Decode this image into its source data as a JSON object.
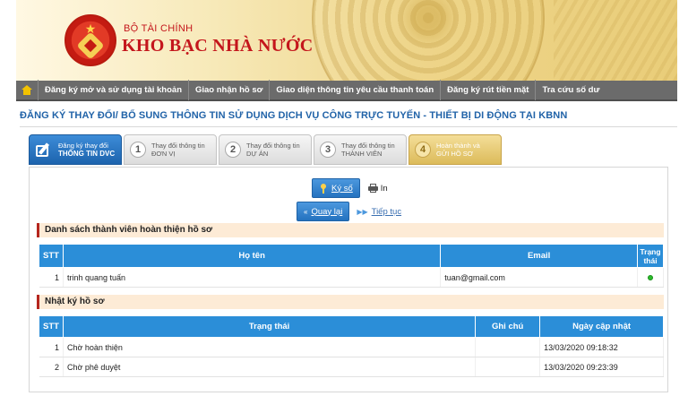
{
  "header": {
    "brand_line1": "BỘ TÀI CHÍNH",
    "brand_line2": "KHO BẠC NHÀ NƯỚC"
  },
  "nav": {
    "items": [
      "Đăng ký mở và sử dụng tài khoản",
      "Giao nhận hồ sơ",
      "Giao diện thông tin yêu cầu thanh toán",
      "Đăng ký rút tiền mặt",
      "Tra cứu số dư"
    ]
  },
  "page_title": "ĐĂNG KÝ THAY ĐỔI/ BỔ SUNG THÔNG TIN SỬ DỤNG DỊCH VỤ CÔNG TRỰC TUYẾN - THIẾT BỊ DI ĐỘNG TẠI KBNN",
  "steps": [
    {
      "num": "",
      "line1": "Đăng ký thay đổi",
      "line2": "THÔNG TIN DVC"
    },
    {
      "num": "1",
      "line1": "Thay đổi thông tin",
      "line2": "ĐƠN VỊ"
    },
    {
      "num": "2",
      "line1": "Thay đổi thông tin",
      "line2": "DỰ ÁN"
    },
    {
      "num": "3",
      "line1": "Thay đổi thông tin",
      "line2": "THÀNH VIÊN"
    },
    {
      "num": "4",
      "line1": "Hoàn thành và",
      "line2": "GỬI HỒ SƠ"
    }
  ],
  "actions": {
    "sign": "Ký số",
    "print": "In",
    "back": "Quay lại",
    "next": "Tiếp tục"
  },
  "members": {
    "title": "Danh sách thành viên hoàn thiện hồ sơ",
    "headers": {
      "stt": "STT",
      "name": "Họ tên",
      "email": "Email",
      "status_l1": "Trạng",
      "status_l2": "thái"
    },
    "rows": [
      {
        "stt": "1",
        "name": "trinh quang tuấn",
        "email": "tuan@gmail.com",
        "status": "active"
      }
    ]
  },
  "log": {
    "title": "Nhật ký hồ sơ",
    "headers": {
      "stt": "STT",
      "status": "Trạng thái",
      "note": "Ghi chú",
      "updated": "Ngày cập nhật"
    },
    "rows": [
      {
        "stt": "1",
        "status": "Chờ hoàn thiện",
        "note": "",
        "updated": "13/03/2020 09:18:32"
      },
      {
        "stt": "2",
        "status": "Chờ phê duyệt",
        "note": "",
        "updated": "13/03/2020 09:23:39"
      }
    ]
  },
  "colors": {
    "primary": "#2b8ed8",
    "brand_red": "#c4161c",
    "title_blue": "#2163a8",
    "status_green": "#2dbb2d"
  }
}
